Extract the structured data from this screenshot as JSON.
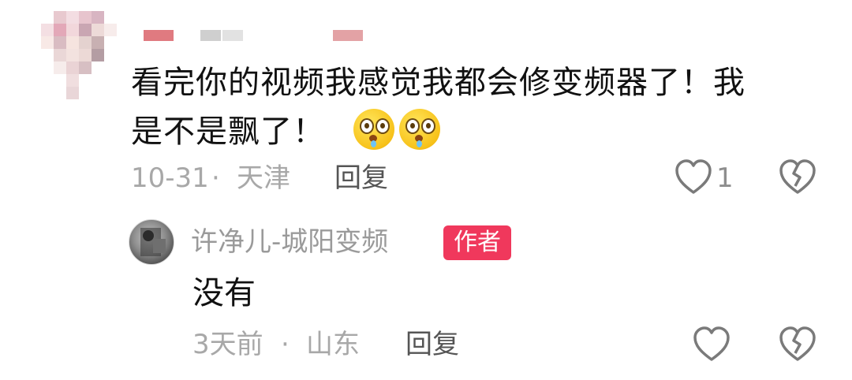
{
  "comment": {
    "text_line1": "看完你的视频我感觉我都会修变频器了！我",
    "text_line2": "是不是飘了！",
    "emojis": [
      "shocked-drooling-emoji",
      "shocked-drooling-emoji"
    ],
    "date": "10-31",
    "separator": "·",
    "location": "天津",
    "reply_label": "回复",
    "like_count": "1"
  },
  "reply": {
    "author_name": "许净儿-城阳变频",
    "author_badge": "作者",
    "text": "没有",
    "date": "3天前",
    "separator": "·",
    "location": "山东",
    "reply_label": "回复"
  },
  "colors": {
    "badge": "#f0385c",
    "meta_text": "#a8a8a8",
    "body_text": "#111111",
    "icon_stroke": "#7a7a7a"
  }
}
